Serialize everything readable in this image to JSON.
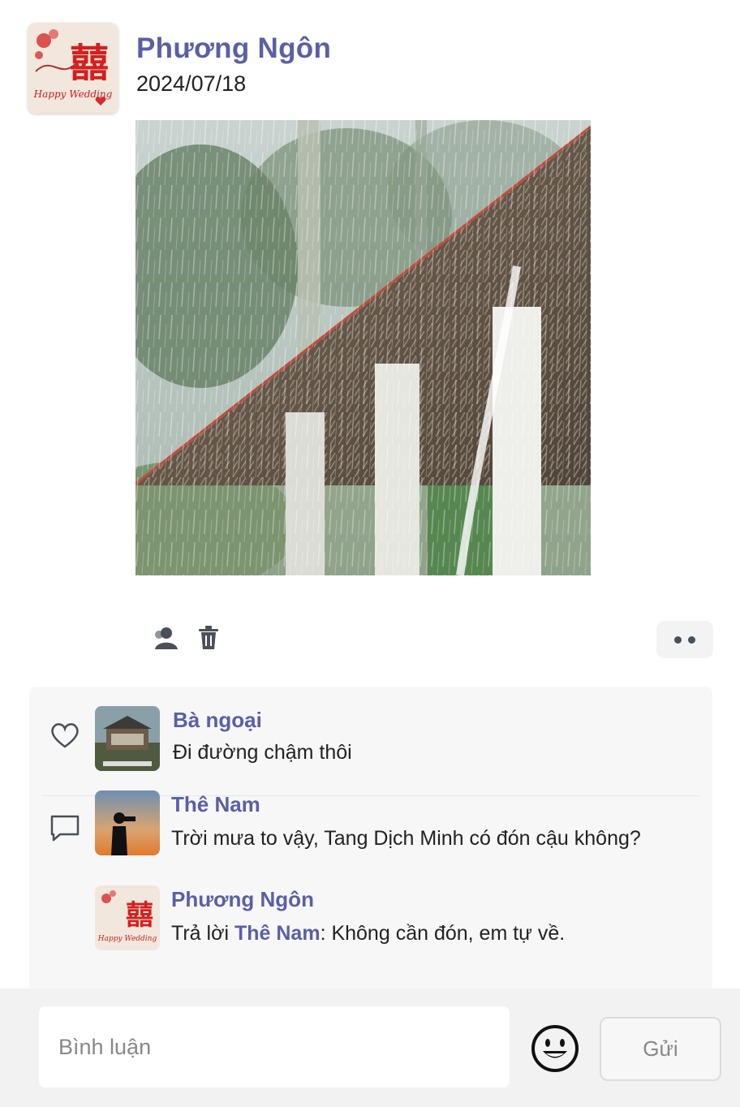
{
  "post": {
    "author": "Phương Ngôn",
    "date": "2024/07/18",
    "avatar_text_top": "囍",
    "avatar_text_bottom": "Happy Wedding",
    "image_description": "rain-on-thatched-roof"
  },
  "actions": {
    "icons": [
      "visibility-people-icon",
      "trash-icon",
      "more-dots-icon"
    ]
  },
  "comments": [
    {
      "author": "Bà ngoại",
      "text": "Đi đường chậm thôi",
      "side_icon": "heart-icon"
    },
    {
      "author": "Thê Nam",
      "text": "Trời mưa to vậy, Tang Dịch Minh có đón cậu không?",
      "side_icon": "comment-icon"
    },
    {
      "author": "Phương Ngôn",
      "reply_prefix": "Trả lời ",
      "reply_to": "Thê Nam",
      "reply_text": ": Không cần đón, em tự về."
    }
  ],
  "composer": {
    "placeholder": "Bình luận",
    "send_label": "Gửi"
  },
  "colors": {
    "accent": "#5a5fa6",
    "text": "#222222",
    "panel": "#f7f7f7"
  }
}
